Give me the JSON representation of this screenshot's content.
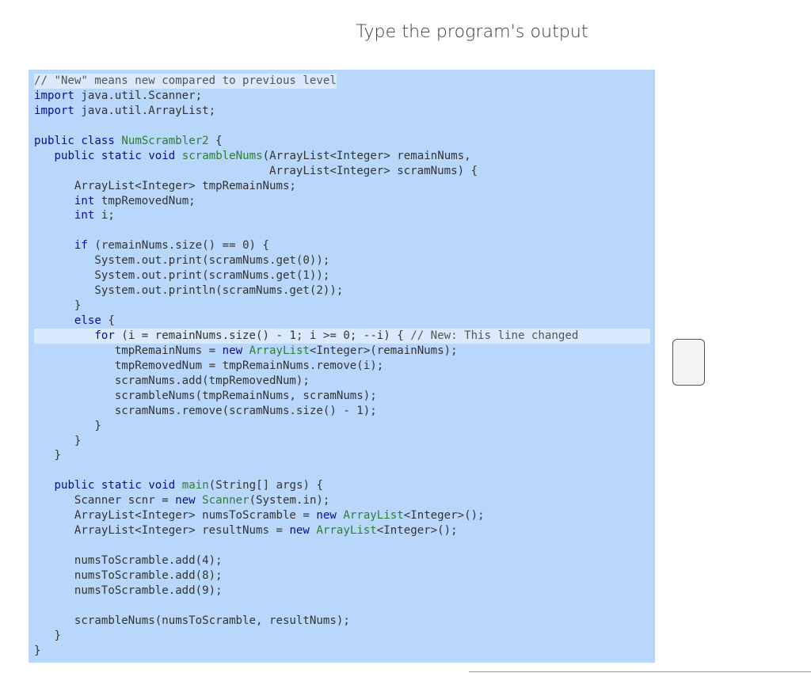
{
  "prompt": {
    "title": "Type the program's output"
  },
  "code": {
    "lines": [
      "// \"New\" means new compared to previous level",
      "import java.util.Scanner;",
      "import java.util.ArrayList;",
      "",
      "public class NumScrambler2 {",
      "   public static void scrambleNums(ArrayList<Integer> remainNums,",
      "                                   ArrayList<Integer> scramNums) {",
      "      ArrayList<Integer> tmpRemainNums;",
      "      int tmpRemovedNum;",
      "      int i;",
      "",
      "      if (remainNums.size() == 0) {",
      "         System.out.print(scramNums.get(0));",
      "         System.out.print(scramNums.get(1));",
      "         System.out.println(scramNums.get(2));",
      "      }",
      "      else {",
      "         for (i = remainNums.size() - 1; i >= 0; --i) { // New: This line changed",
      "            tmpRemainNums = new ArrayList<Integer>(remainNums);",
      "            tmpRemovedNum = tmpRemainNums.remove(i);",
      "            scramNums.add(tmpRemovedNum);",
      "            scrambleNums(tmpRemainNums, scramNums);",
      "            scramNums.remove(scramNums.size() - 1);",
      "         }",
      "      }",
      "   }",
      "",
      "   public static void main(String[] args) {",
      "      Scanner scnr = new Scanner(System.in);",
      "      ArrayList<Integer> numsToScramble = new ArrayList<Integer>();",
      "      ArrayList<Integer> resultNums = new ArrayList<Integer>();",
      "",
      "      numsToScramble.add(4);",
      "      numsToScramble.add(8);",
      "      numsToScramble.add(9);",
      "",
      "      scrambleNums(numsToScramble, resultNums);",
      "   }",
      "}"
    ]
  },
  "answer": {
    "value": ""
  }
}
